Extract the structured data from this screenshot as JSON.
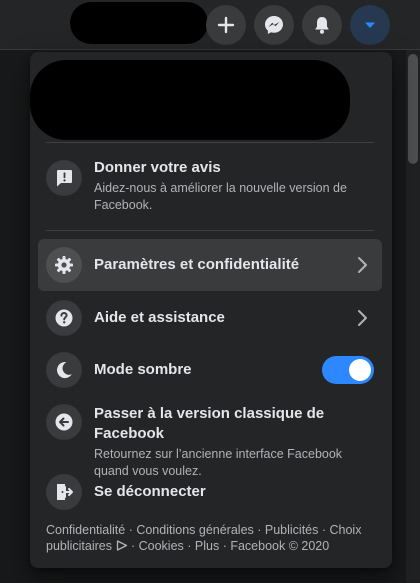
{
  "topbar": {
    "buttons": [
      {
        "icon": "plus-icon"
      },
      {
        "icon": "messenger-icon"
      },
      {
        "icon": "bell-icon"
      },
      {
        "icon": "caret-down-icon",
        "accent": "#2d88ff"
      }
    ]
  },
  "menu": {
    "feedback": {
      "title": "Donner votre avis",
      "subtitle": "Aidez-nous à améliorer la nouvelle version de Facebook."
    },
    "settings": {
      "title": "Paramètres et confidentialité"
    },
    "help": {
      "title": "Aide et assistance"
    },
    "dark_mode": {
      "title": "Mode sombre",
      "enabled": true
    },
    "classic": {
      "title": "Passer à la version classique de Facebook",
      "subtitle": "Retournez sur l’ancienne interface Facebook quand vous voulez."
    },
    "logout": {
      "title": "Se déconnecter"
    }
  },
  "footer": {
    "privacy": "Confidentialité",
    "terms": "Conditions générales",
    "ads": "Publicités",
    "ad_choices": "Choix publicitaires",
    "cookies": "Cookies",
    "more": "Plus",
    "copyright": "Facebook © 2020"
  },
  "colors": {
    "background": "#18191a",
    "surface": "#242526",
    "accent": "#2d88ff"
  }
}
